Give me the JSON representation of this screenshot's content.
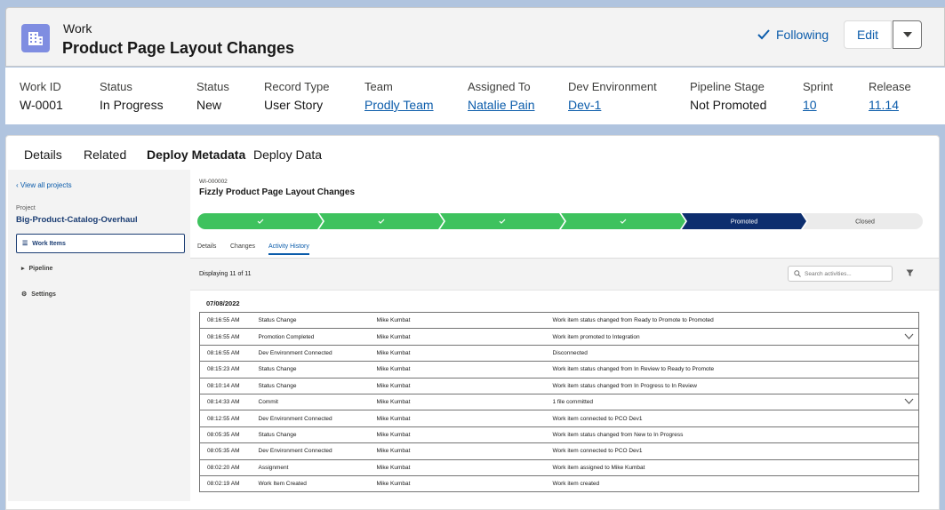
{
  "header": {
    "object_type": "Work",
    "title": "Product Page Layout Changes",
    "following_label": "Following",
    "edit_label": "Edit"
  },
  "highlights": [
    {
      "label": "Work ID",
      "value": "W-0001",
      "link": false
    },
    {
      "label": "Status",
      "value": "In Progress",
      "link": false
    },
    {
      "label": "Status",
      "value": "New",
      "link": false
    },
    {
      "label": "Record Type",
      "value": "User Story",
      "link": false
    },
    {
      "label": "Team",
      "value": "Prodly Team",
      "link": true
    },
    {
      "label": "Assigned To",
      "value": "Natalie Pain",
      "link": true
    },
    {
      "label": "Dev Environment",
      "value": "Dev-1",
      "link": true
    },
    {
      "label": "Pipeline Stage",
      "value": "Not Promoted",
      "link": false
    },
    {
      "label": "Sprint",
      "value": "10",
      "link": true
    },
    {
      "label": "Release",
      "value": "11.14",
      "link": true
    }
  ],
  "tabs": [
    "Details",
    "Related",
    "Deploy Metadata",
    "Deploy Data"
  ],
  "active_tab": "Deploy Metadata",
  "sidebar": {
    "back_label": "View all projects",
    "project_label": "Project",
    "project_name": "Big-Product-Catalog-Overhaul",
    "nav": [
      {
        "label": "Work Items",
        "icon": "list-icon",
        "active": true
      },
      {
        "label": "Pipeline",
        "icon": "pipeline-icon",
        "active": false
      },
      {
        "label": "Settings",
        "icon": "gear-icon",
        "active": false
      }
    ]
  },
  "work_item": {
    "id": "WI-000002",
    "title": "Fizzly Product Page Layout Changes"
  },
  "path": {
    "stages": [
      "",
      "",
      "",
      "",
      "Promoted",
      "Closed"
    ],
    "states": [
      "complete",
      "complete",
      "complete",
      "complete",
      "current",
      "incomplete"
    ]
  },
  "subtabs": [
    "Details",
    "Changes",
    "Activity History"
  ],
  "active_subtab": "Activity History",
  "toolbar": {
    "displaying": "Displaying 11 of 11",
    "search_placeholder": "Search activities..."
  },
  "activity": {
    "date": "07/08/2022",
    "rows": [
      {
        "time": "08:16:55 AM",
        "type": "Status Change",
        "user": "Mike Kumbat",
        "detail": "Work item status changed from Ready to Promote to Promoted",
        "expandable": false
      },
      {
        "time": "08:16:55 AM",
        "type": "Promotion Completed",
        "user": "Mike Kumbat",
        "detail": "Work item promoted to Integration",
        "expandable": true
      },
      {
        "time": "08:16:55 AM",
        "type": "Dev Environment Connected",
        "user": "Mike Kumbat",
        "detail": "Disconnected",
        "expandable": false
      },
      {
        "time": "08:15:23 AM",
        "type": "Status Change",
        "user": "Mike Kumbat",
        "detail": "Work item status changed from In Review to Ready to Promote",
        "expandable": false
      },
      {
        "time": "08:10:14 AM",
        "type": "Status Change",
        "user": "Mike Kumbat",
        "detail": "Work item status changed from In Progress to In Review",
        "expandable": false
      },
      {
        "time": "08:14:33 AM",
        "type": "Commit",
        "user": "Mike Kumbat",
        "detail": "1 file committed",
        "expandable": true
      },
      {
        "time": "08:12:55 AM",
        "type": "Dev Environment Connected",
        "user": "Mike Kumbat",
        "detail": "Work item connected to PCO Dev1",
        "expandable": false
      },
      {
        "time": "08:05:35 AM",
        "type": "Status Change",
        "user": "Mike Kumbat",
        "detail": "Work item status changed from New to In Progress",
        "expandable": false
      },
      {
        "time": "08:05:35 AM",
        "type": "Dev Environment Connected",
        "user": "Mike Kumbat",
        "detail": "Work item connected to PCO Dev1",
        "expandable": false
      },
      {
        "time": "08:02:20 AM",
        "type": "Assignment",
        "user": "Mike Kumbat",
        "detail": "Work item assigned to Mike Kumbat",
        "expandable": false
      },
      {
        "time": "08:02:19 AM",
        "type": "Work Item Created",
        "user": "Mike Kumbat",
        "detail": "Work item created",
        "expandable": false
      }
    ]
  },
  "colors": {
    "path_complete": "#3ec25e",
    "path_current": "#0d2e6e",
    "path_incomplete": "#ebebeb",
    "link": "#0b5cab",
    "object_icon": "#7f8de1"
  }
}
